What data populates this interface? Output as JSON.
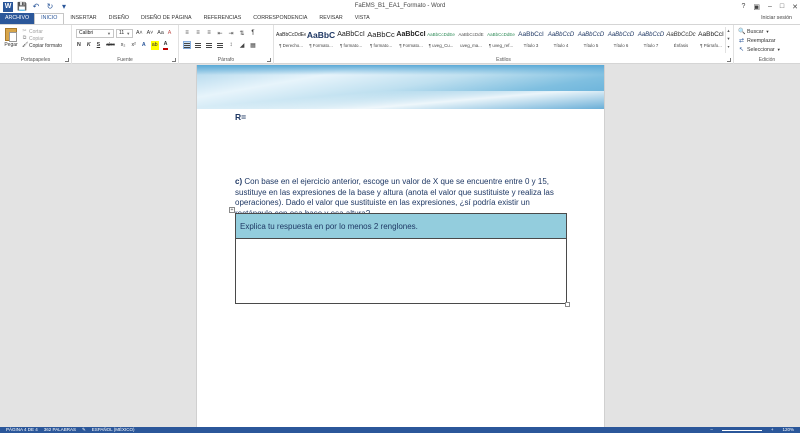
{
  "window": {
    "title": "FaEMS_B1_EA1_Formato - Word",
    "help": "?",
    "controls": [
      "▣",
      "–",
      "□",
      "✕"
    ]
  },
  "qat": {
    "save_icon": "save-icon",
    "undo_icon": "undo-icon",
    "redo_icon": "redo-icon",
    "customize_icon": "customize-icon"
  },
  "tabs": [
    "ARCHIVO",
    "INICIO",
    "INSERTAR",
    "DISEÑO",
    "DISEÑO DE PÁGINA",
    "REFERENCIAS",
    "CORRESPONDENCIA",
    "REVISAR",
    "VISTA"
  ],
  "active_tab": "INICIO",
  "signin": "Iniciar sesión",
  "ribbon": {
    "clipboard": {
      "label": "Portapapeles",
      "paste": "Pegar",
      "cut": "Cortar",
      "copy": "Copiar",
      "format_painter": "Copiar formato"
    },
    "font": {
      "label": "Fuente",
      "family": "Calibri",
      "size": "11",
      "grow": "A˄",
      "shrink": "A˅",
      "case": "Aa",
      "clear": "A",
      "bold": "N",
      "italic": "K",
      "underline": "S",
      "strike": "abc",
      "sub": "x₂",
      "sup": "x²",
      "effects": "A",
      "highlight": "ab",
      "color": "A"
    },
    "paragraph": {
      "label": "Párrafo",
      "show_marks": "¶"
    },
    "styles": {
      "label": "Estilos",
      "items": [
        {
          "sample": "AaBbCcDdEe",
          "name": "¶ Derecho..."
        },
        {
          "sample": "AaBbC",
          "name": "¶ Formato..."
        },
        {
          "sample": "AaBbCcI",
          "name": "¶ formato..."
        },
        {
          "sample": "AaBbCc",
          "name": "¶ formato..."
        },
        {
          "sample": "AaBbCcI",
          "name": "¶ Formato..."
        },
        {
          "sample": "AaBbCcDdEe",
          "name": "¶ uveg_Cu..."
        },
        {
          "sample": "AaBbCcDdE",
          "name": "uveg_ma..."
        },
        {
          "sample": "AaBbCcDdEe",
          "name": "¶ uveg_ref..."
        },
        {
          "sample": "AaBbCcI",
          "name": "Título 3"
        },
        {
          "sample": "AaBbCcD",
          "name": "Título 4"
        },
        {
          "sample": "AaBbCcD",
          "name": "Título 5"
        },
        {
          "sample": "AaBbCcD",
          "name": "Título 6"
        },
        {
          "sample": "AaBbCcD",
          "name": "Título 7"
        },
        {
          "sample": "AaBbCcDc",
          "name": "Énfasis"
        },
        {
          "sample": "AaBbCcI",
          "name": "¶ Párrafo..."
        }
      ]
    },
    "editing": {
      "label": "Edición",
      "find": "Buscar",
      "replace": "Reemplazar",
      "select": "Seleccionar"
    }
  },
  "document": {
    "r_label": "R=",
    "question_letter": "c)",
    "question_text": " Con base en el ejercicio anterior, escoge un valor de X que se encuentre entre 0 y 15, sustituye en las expresiones de la base y altura (anota el valor que sustituiste y realiza las operaciones). Dado el valor que sustituiste en las expresiones, ¿sí podría existir un rectángulo con esa base y esa altura?",
    "table_header": "Explica tu respuesta en por lo menos 2 renglones.",
    "table_body": ""
  },
  "status": {
    "page": "PÁGINA 4 DE 4",
    "words": "362 PALABRAS",
    "language": "ESPAÑOL (MÉXICO)",
    "zoom": "120%"
  }
}
